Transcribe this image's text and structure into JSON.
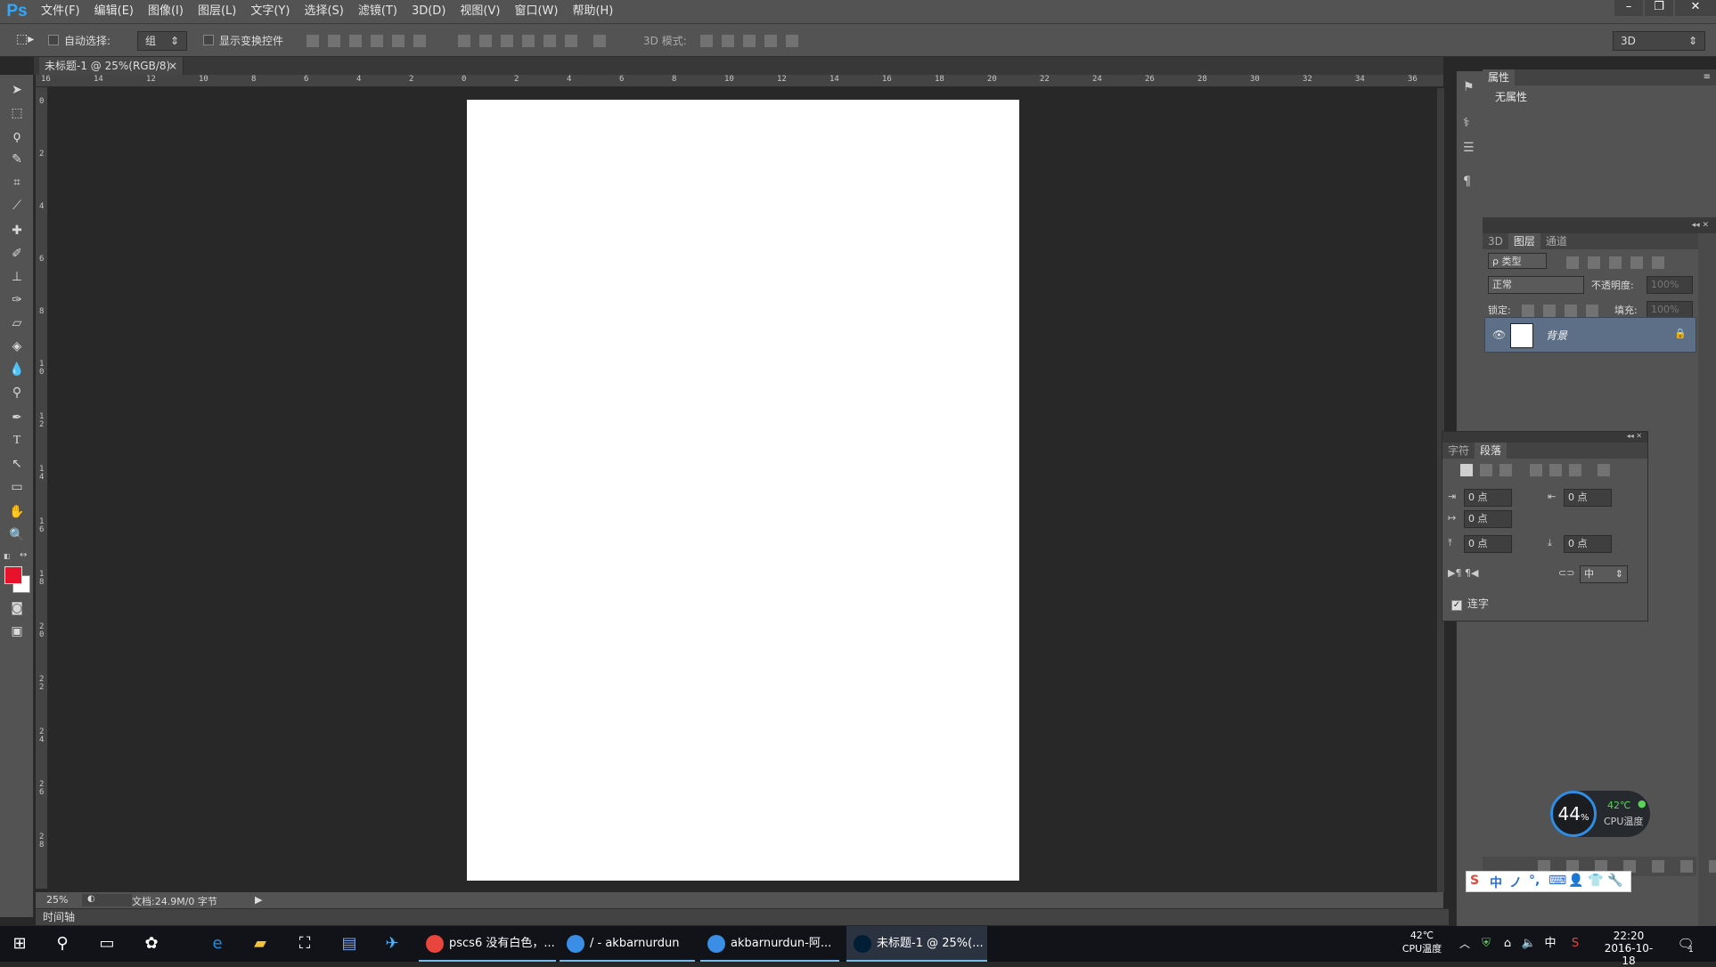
{
  "app": {
    "logo": "Ps"
  },
  "menu": [
    "文件(F)",
    "编辑(E)",
    "图像(I)",
    "图层(L)",
    "文字(Y)",
    "选择(S)",
    "滤镜(T)",
    "3D(D)",
    "视图(V)",
    "窗口(W)",
    "帮助(H)"
  ],
  "window_controls": {
    "minimize": "–",
    "restore": "❐",
    "close": "✕"
  },
  "options": {
    "auto_select_label": "自动选择:",
    "auto_select_value": "组",
    "show_transform_label": "显示变换控件",
    "mode_label": "3D 模式:",
    "workspace_value": "3D"
  },
  "document": {
    "tab_title": "未标题-1 @ 25%(RGB/8)",
    "close": "×"
  },
  "rulers": {
    "h": [
      "16",
      "14",
      "12",
      "10",
      "8",
      "6",
      "4",
      "2",
      "0",
      "2",
      "4",
      "6",
      "8",
      "10",
      "12",
      "14",
      "16",
      "18",
      "20",
      "22",
      "24",
      "26",
      "28",
      "30",
      "32",
      "34",
      "36"
    ],
    "v": [
      "0",
      "2",
      "4",
      "6",
      "8",
      "1\n0",
      "1\n2",
      "1\n4",
      "1\n6",
      "1\n8",
      "2\n0",
      "2\n2",
      "2\n4",
      "2\n6",
      "2\n8"
    ]
  },
  "status": {
    "zoom": "25%",
    "doc_info": "文档:24.9M/0 字节"
  },
  "timeline": {
    "label": "时间轴"
  },
  "properties": {
    "tab": "属性",
    "content": "无属性"
  },
  "layers_panel": {
    "tabs": [
      "3D",
      "图层",
      "通道"
    ],
    "active_tab": "图层",
    "filter_label": "ρ 类型",
    "blend_mode": "正常",
    "opacity_label": "不透明度:",
    "opacity_value": "100%",
    "lock_label": "锁定:",
    "fill_label": "填充:",
    "fill_value": "100%",
    "layer_name": "背景"
  },
  "paragraph_panel": {
    "tabs": [
      "字符",
      "段落"
    ],
    "active_tab": "段落",
    "indent_left": "0 点",
    "indent_right": "0 点",
    "first_line": "0 点",
    "space_before": "0 点",
    "space_after": "0 点",
    "hyphen_value": "中",
    "hyphenate_label": "连字"
  },
  "cpu_widget": {
    "percent": "44",
    "percent_sign": "%",
    "temp": "42℃",
    "label": "CPU温度"
  },
  "taskbar": {
    "apps": [
      {
        "label": "pscs6 没有白色，...",
        "color": "#e8453c"
      },
      {
        "label": "/ - akbarnurdun",
        "color": "#3a8ee6"
      },
      {
        "label": "akbarnurdun-阿...",
        "color": "#3a8ee6"
      },
      {
        "label": "未标题-1 @ 25%(...",
        "color": "#001e36"
      }
    ],
    "temp": "42℃",
    "temp_label": "CPU温度",
    "ime": "中",
    "time": "22:20",
    "date": "2016-10-18",
    "notif_count": "1"
  },
  "ime_bar": {
    "items": [
      "S",
      "中",
      "ノ",
      "°,",
      "⌨",
      "👤",
      "👕",
      "🔧"
    ]
  }
}
